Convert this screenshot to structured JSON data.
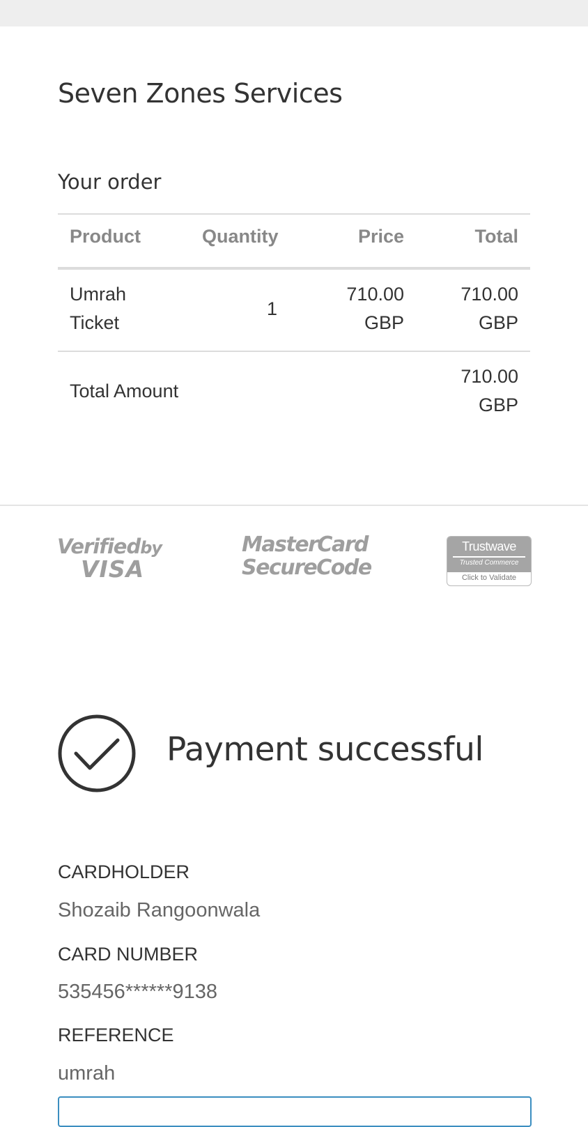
{
  "merchant": {
    "name": "Seven Zones Services"
  },
  "order": {
    "heading": "Your order",
    "columns": {
      "product": "Product",
      "quantity": "Quantity",
      "price": "Price",
      "total": "Total"
    },
    "items": [
      {
        "product_line1": "Umrah",
        "product_line2": "Ticket",
        "quantity": "1",
        "price_amount": "710.00",
        "price_currency": "GBP",
        "total_amount": "710.00",
        "total_currency": "GBP"
      }
    ],
    "total_label": "Total Amount",
    "total_amount": "710.00",
    "total_currency": "GBP"
  },
  "security_logos": {
    "visa": {
      "line1": "Verified",
      "line1_small": "by",
      "line2": "VISA"
    },
    "mastercard": {
      "line1": "MasterCard",
      "line2": "SecureCode"
    },
    "trustwave": {
      "brand": "Trustwave",
      "sub": "Trusted Commerce",
      "validate": "Click to Validate"
    }
  },
  "status": {
    "icon": "check-circle-icon",
    "message": "Payment successful"
  },
  "details": {
    "cardholder_label": "CARDHOLDER",
    "cardholder_value": "Shozaib Rangoonwala",
    "card_number_label": "CARD NUMBER",
    "card_number_value": "535456******9138",
    "reference_label": "REFERENCE",
    "reference_value": "umrah"
  },
  "colors": {
    "text_primary": "#333333",
    "text_muted": "#888888",
    "logo_gray": "#9e9e9e",
    "focus_border": "#3b8ec0"
  }
}
